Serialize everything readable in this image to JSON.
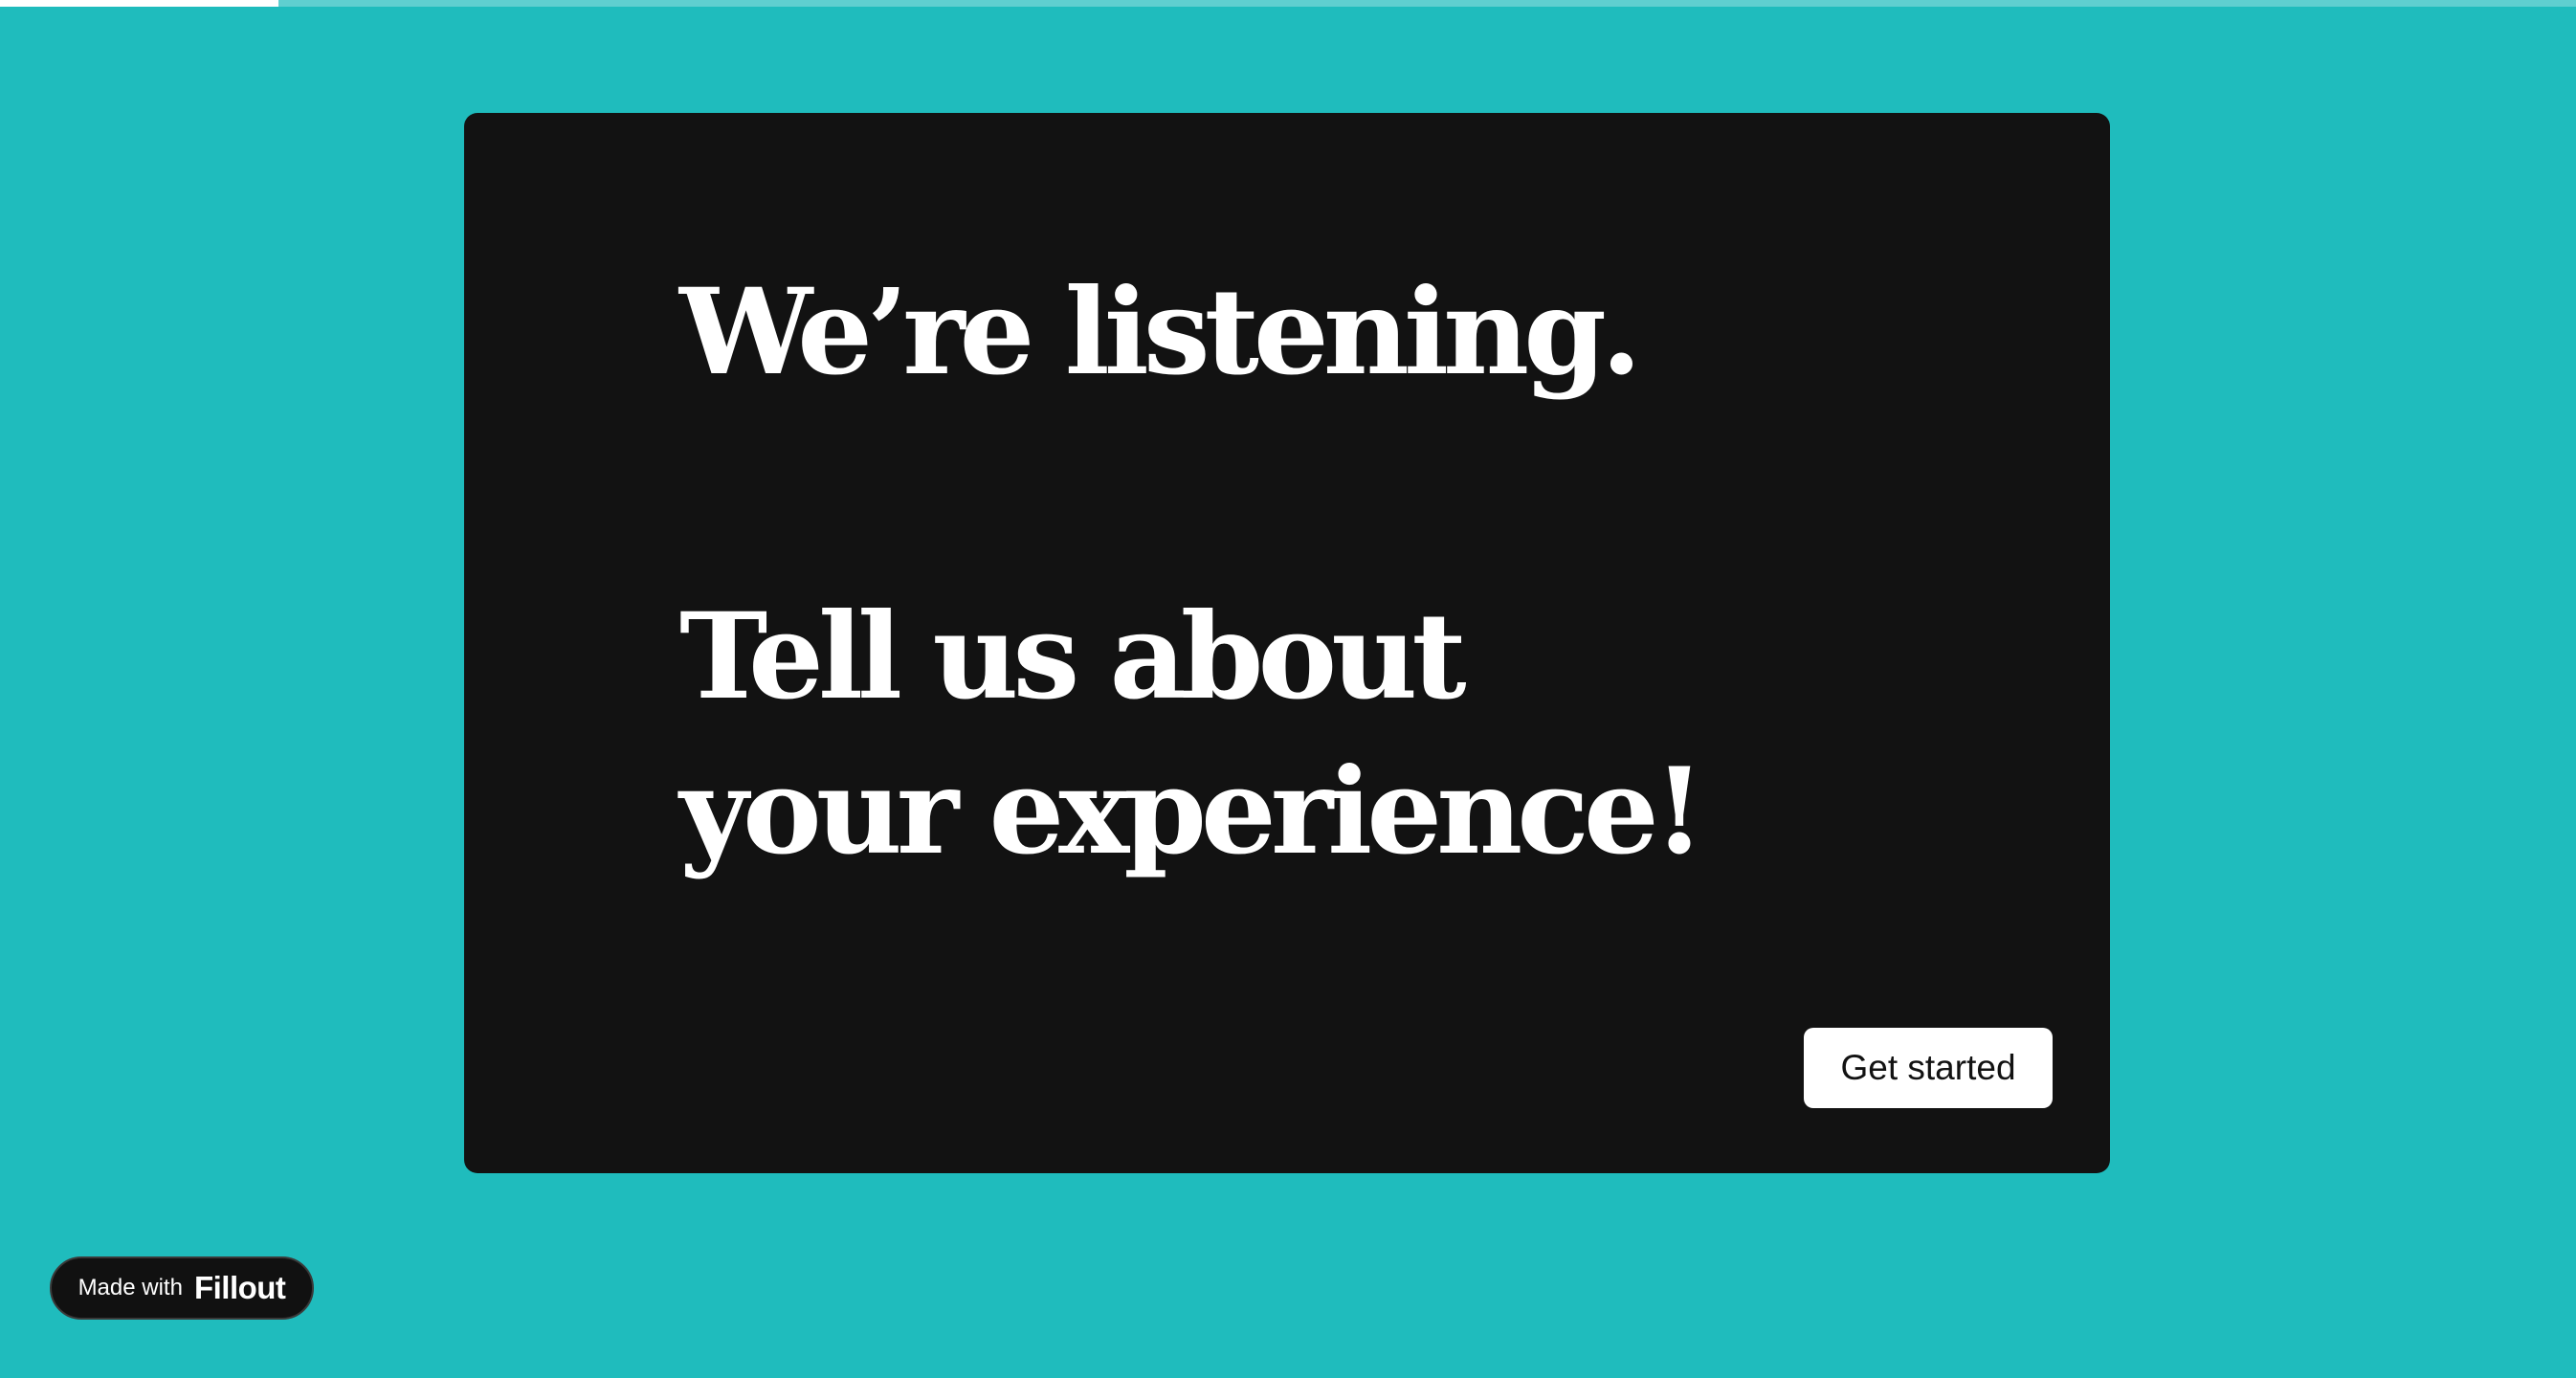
{
  "colors": {
    "background": "#1fbcbd",
    "card": "#121212",
    "text": "#ffffff",
    "button_bg": "#ffffff",
    "button_text": "#121212"
  },
  "progress": {
    "fraction": 0.108
  },
  "card": {
    "heading_line_1": "We’re listening.",
    "heading_line_2": "Tell us about",
    "heading_line_3": "your experience!",
    "button_label": "Get started"
  },
  "badge": {
    "prefix": "Made with",
    "brand": "Fillout"
  }
}
